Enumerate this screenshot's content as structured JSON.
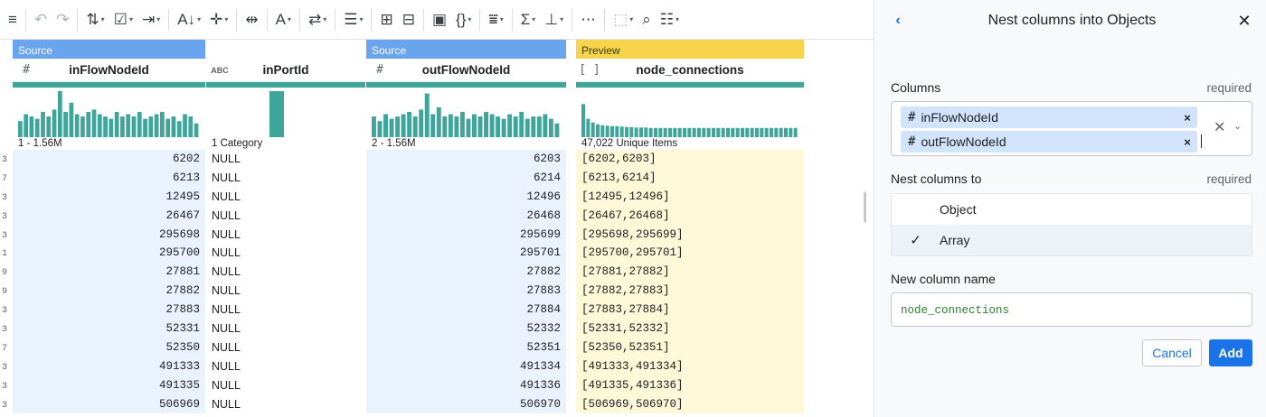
{
  "toolbar": {
    "items": [
      {
        "icon": "menu-icon",
        "glyph": "≡"
      },
      {
        "icon": "undo-icon",
        "glyph": "↶"
      },
      {
        "icon": "redo-icon",
        "glyph": "↷"
      },
      {
        "icon": "restructure-icon",
        "glyph": "⇅"
      },
      {
        "icon": "filter-rows-icon",
        "glyph": "☑"
      },
      {
        "icon": "merge-icon",
        "glyph": "⇥"
      },
      {
        "icon": "sort-icon",
        "glyph": "A↓"
      },
      {
        "icon": "move-icon",
        "glyph": "✛"
      },
      {
        "icon": "split-icon",
        "glyph": "⇹"
      },
      {
        "icon": "text-icon",
        "glyph": "A"
      },
      {
        "icon": "replace-icon",
        "glyph": "⇄"
      },
      {
        "icon": "rows-icon",
        "glyph": "☰"
      },
      {
        "icon": "pivot-icon",
        "glyph": "⊞"
      },
      {
        "icon": "columns-icon",
        "glyph": "⊟"
      },
      {
        "icon": "structure-icon",
        "glyph": "▣"
      },
      {
        "icon": "braces-icon",
        "glyph": "{}"
      },
      {
        "icon": "filter-icon",
        "glyph": "⩸"
      },
      {
        "icon": "sum-icon",
        "glyph": "Σ"
      },
      {
        "icon": "join-icon",
        "glyph": "⊥"
      },
      {
        "icon": "more-icon",
        "glyph": "⋯"
      },
      {
        "icon": "select-icon",
        "glyph": "⬚"
      },
      {
        "icon": "lookup-icon",
        "glyph": "⌕"
      },
      {
        "icon": "settings-sliders-icon",
        "glyph": "☷"
      }
    ]
  },
  "row_index": [
    "3",
    "7",
    "3",
    "3",
    "3",
    "1",
    "9",
    "9",
    "3",
    "3",
    "7",
    "3",
    "3",
    "3"
  ],
  "grid": {
    "columns": [
      {
        "id": "inFlowNodeId",
        "banner": "Source",
        "type_glyph": "#",
        "name": "inFlowNodeId",
        "hist_label": "1 - 1.56M",
        "hist": [
          0.35,
          0.5,
          0.45,
          0.4,
          0.55,
          0.45,
          0.6,
          1.0,
          0.55,
          0.75,
          0.5,
          0.45,
          0.55,
          0.6,
          0.5,
          0.45,
          0.4,
          0.55,
          0.45,
          0.5,
          0.45,
          0.55,
          0.4,
          0.45,
          0.5,
          0.55,
          0.4,
          0.45,
          0.35,
          0.5,
          0.45,
          0.3
        ],
        "values": [
          "6202",
          "6213",
          "12495",
          "26467",
          "295698",
          "295700",
          "27881",
          "27882",
          "27883",
          "52331",
          "52350",
          "491333",
          "491335",
          "506969"
        ]
      },
      {
        "id": "inPortId",
        "banner": "",
        "type_glyph": "ABC",
        "name": "inPortId",
        "hist_label": "1 Category",
        "hist": [
          1.0
        ],
        "values": [
          "NULL",
          "NULL",
          "NULL",
          "NULL",
          "NULL",
          "NULL",
          "NULL",
          "NULL",
          "NULL",
          "NULL",
          "NULL",
          "NULL",
          "NULL",
          "NULL"
        ]
      },
      {
        "id": "outFlowNodeId",
        "banner": "Source",
        "type_glyph": "#",
        "name": "outFlowNodeId",
        "hist_label": "2 - 1.56M",
        "hist": [
          0.45,
          0.35,
          0.5,
          0.4,
          0.45,
          0.5,
          0.55,
          0.45,
          0.6,
          0.95,
          0.5,
          0.65,
          0.45,
          0.5,
          0.45,
          0.55,
          0.4,
          0.5,
          0.45,
          0.55,
          0.5,
          0.45,
          0.4,
          0.5,
          0.45,
          0.55,
          0.4,
          0.45,
          0.45,
          0.5,
          0.4,
          0.3
        ],
        "values": [
          "6203",
          "6214",
          "12496",
          "26468",
          "295699",
          "295701",
          "27882",
          "27883",
          "27884",
          "52332",
          "52351",
          "491334",
          "491336",
          "506970"
        ]
      },
      {
        "id": "node_connections",
        "banner": "Preview",
        "type_glyph": "[ ]",
        "name": "node_connections",
        "hist_label": "47,022 Unique Items",
        "hist": [
          0.72,
          0.4,
          0.32,
          0.28,
          0.26,
          0.25,
          0.24,
          0.24,
          0.23,
          0.22,
          0.22,
          0.21,
          0.21,
          0.21,
          0.2,
          0.2,
          0.2,
          0.2,
          0.2,
          0.2,
          0.2,
          0.2,
          0.2,
          0.2,
          0.2,
          0.2,
          0.2,
          0.2,
          0.2,
          0.2,
          0.2,
          0.2,
          0.2,
          0.2,
          0.2,
          0.2,
          0.2,
          0.2,
          0.2,
          0.2,
          0.2,
          0.2,
          0.2,
          0.2,
          0.2
        ],
        "values": [
          "[6202,6203]",
          "[6213,6214]",
          "[12495,12496]",
          "[26467,26468]",
          "[295698,295699]",
          "[295700,295701]",
          "[27881,27882]",
          "[27882,27883]",
          "[27883,27884]",
          "[52331,52332]",
          "[52350,52351]",
          "[491333,491334]",
          "[491335,491336]",
          "[506969,506970]"
        ]
      }
    ],
    "hist_color": "#3fa49a"
  },
  "panel": {
    "title": "Nest columns into Objects",
    "columns_label": "Columns",
    "columns_required": "required",
    "chips": [
      {
        "glyph": "#",
        "label": "inFlowNodeId"
      },
      {
        "glyph": "#",
        "label": "outFlowNodeId"
      }
    ],
    "nest_label": "Nest columns to",
    "nest_required": "required",
    "options": [
      {
        "label": "Object",
        "selected": false
      },
      {
        "label": "Array",
        "selected": true
      }
    ],
    "new_name_label": "New column name",
    "new_name_value": "node_connections",
    "cancel_label": "Cancel",
    "add_label": "Add",
    "accent": "#1a73e8"
  }
}
